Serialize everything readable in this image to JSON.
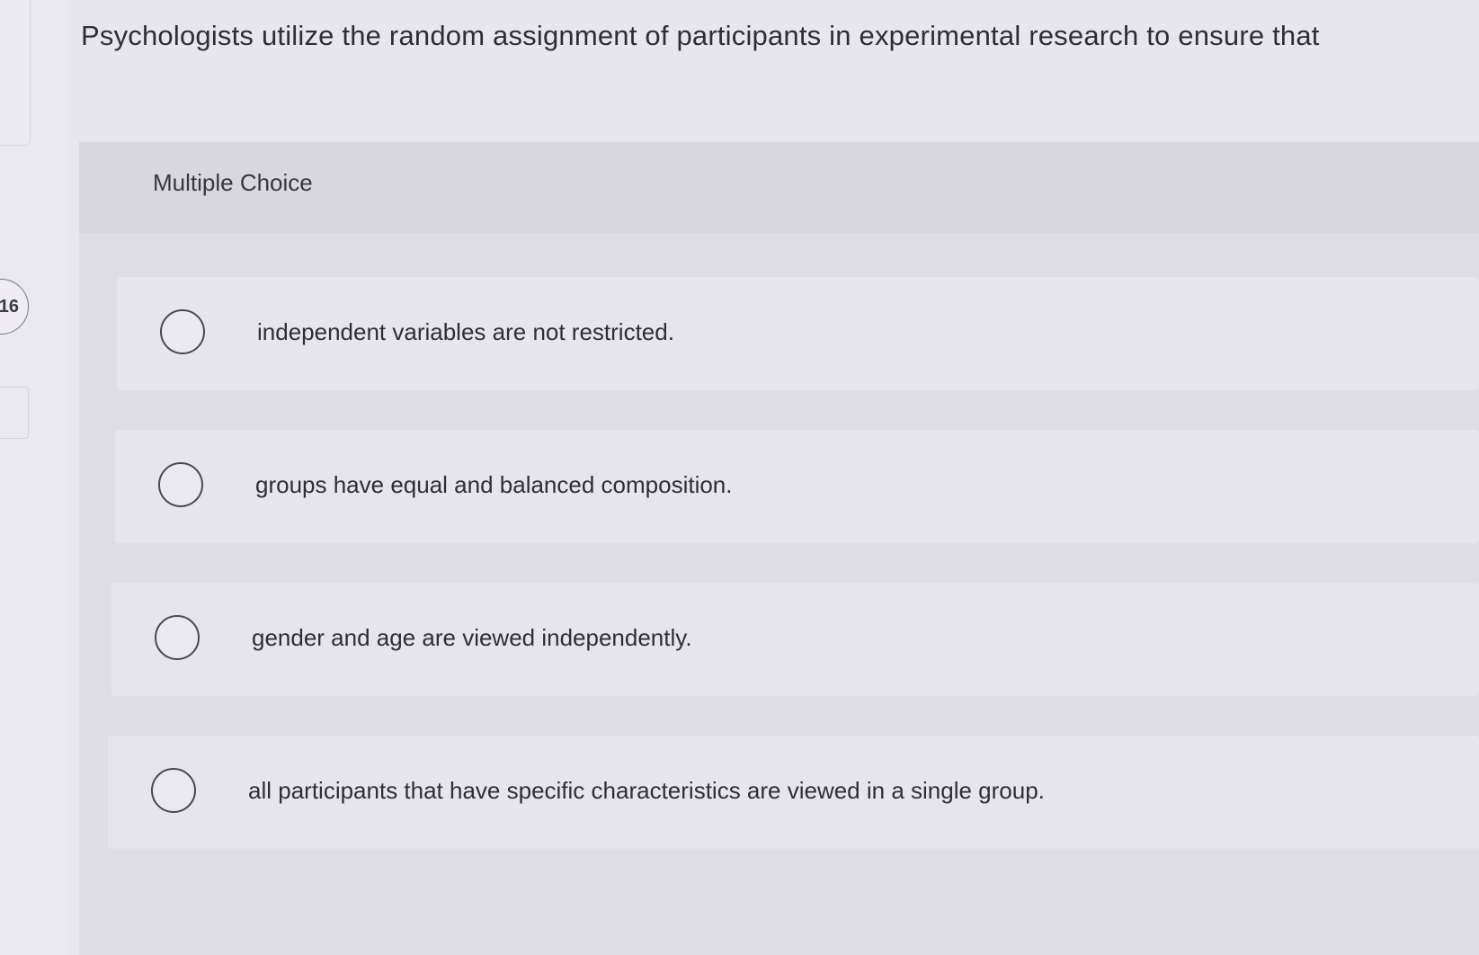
{
  "question": {
    "number": "16",
    "text": "Psychologists utilize the random assignment of participants in experimental research to ensure that"
  },
  "multiple_choice": {
    "title": "Multiple Choice",
    "options": [
      {
        "label": "independent variables are not restricted."
      },
      {
        "label": "groups have equal and balanced composition."
      },
      {
        "label": "gender and age are viewed independently."
      },
      {
        "label": "all participants that have specific characteristics are viewed in a single group."
      }
    ]
  }
}
